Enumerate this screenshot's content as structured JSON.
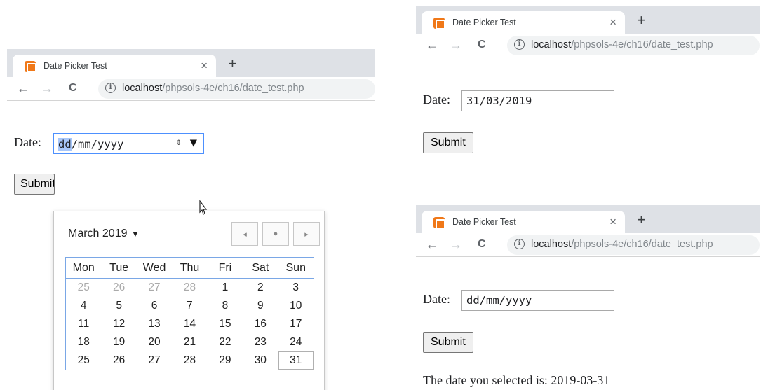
{
  "tab": {
    "title": "Date Picker Test",
    "close_glyph": "×",
    "newtab_glyph": "+"
  },
  "nav": {
    "back_glyph": "←",
    "forward_glyph": "→",
    "reload_glyph": "C",
    "info_glyph": "i"
  },
  "url": {
    "host": "localhost",
    "path": "/phpsols-4e/ch16/date_test.php"
  },
  "form": {
    "date_label": "Date:",
    "submit_label": "Submit",
    "placeholder_day": "dd",
    "placeholder_rest": "/mm/yyyy"
  },
  "left_window": {
    "spinner_glyph": "⇕",
    "dropdown_glyph": "▼"
  },
  "picker": {
    "month_label": "March 2019",
    "caret_glyph": "▼",
    "prev_glyph": "◂",
    "today_glyph": "●",
    "next_glyph": "▸",
    "weekdays": [
      "Mon",
      "Tue",
      "Wed",
      "Thu",
      "Fri",
      "Sat",
      "Sun"
    ],
    "weeks": [
      [
        "25",
        "26",
        "27",
        "28",
        "1",
        "2",
        "3"
      ],
      [
        "4",
        "5",
        "6",
        "7",
        "8",
        "9",
        "10"
      ],
      [
        "11",
        "12",
        "13",
        "14",
        "15",
        "16",
        "17"
      ],
      [
        "18",
        "19",
        "20",
        "21",
        "22",
        "23",
        "24"
      ],
      [
        "25",
        "26",
        "27",
        "28",
        "29",
        "30",
        "31"
      ]
    ]
  },
  "top_right": {
    "date_value": "31/03/2019"
  },
  "bottom_right": {
    "date_value": "dd/mm/yyyy",
    "result_text": "The date you selected is: 2019-03-31"
  }
}
